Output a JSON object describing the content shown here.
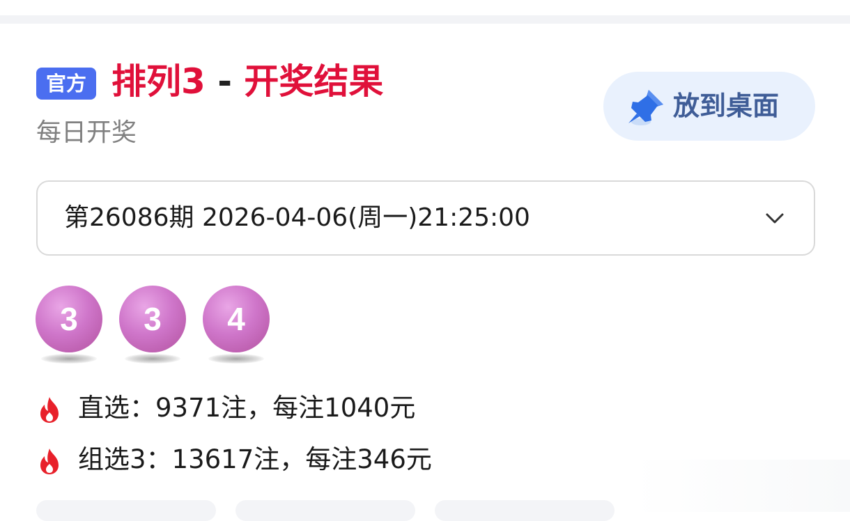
{
  "header": {
    "badge": "官方",
    "title_game": "排列3",
    "title_sep": " - ",
    "title_result": "开奖结果",
    "subtitle": "每日开奖",
    "pin_label": "放到桌面",
    "pin_icon": "pin-icon"
  },
  "issue": {
    "selected": "第26086期 2026-04-06(周一)21:25:00",
    "chevron_icon": "chevron-down-icon"
  },
  "balls": [
    "3",
    "3",
    "4"
  ],
  "prizes": [
    {
      "icon": "fire-icon",
      "text": "直选：9371注，每注1040元"
    },
    {
      "icon": "fire-icon",
      "text": "组选3：13617注，每注346元"
    }
  ],
  "colors": {
    "accent_red": "#e0103a",
    "badge_blue": "#4b6ef0",
    "ball_purple": "#c96fc2",
    "pin_bg": "#e9f1fd",
    "pin_text": "#3f5d97",
    "fire_red": "#e8202a"
  }
}
